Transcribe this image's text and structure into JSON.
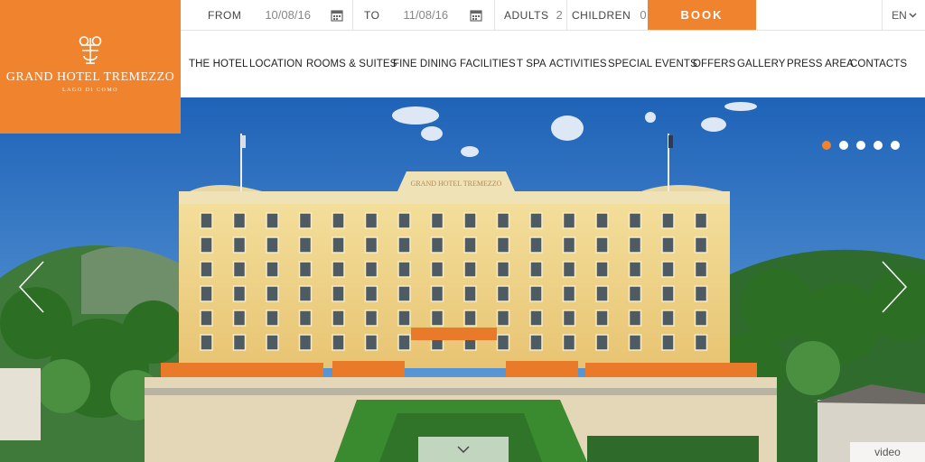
{
  "brand": {
    "name": "GRAND HOTEL TREMEZZO",
    "tagline": "LAGO DI COMO",
    "accent_color": "#f0832d"
  },
  "booking": {
    "from_label": "FROM",
    "from_value": "10/08/16",
    "to_label": "TO",
    "to_value": "11/08/16",
    "adults_label": "ADULTS",
    "adults_value": "2",
    "children_label": "CHILDREN",
    "children_value": "0",
    "book_label": "BOOK",
    "calendar_icon": "calendar-icon"
  },
  "language": {
    "selected": "EN",
    "icon": "chevron-down-icon"
  },
  "nav": {
    "items": [
      "THE HOTEL",
      "LOCATION",
      "ROOMS & SUITES",
      "FINE DINING",
      "FACILITIES",
      "T SPA",
      "ACTIVITIES",
      "SPECIAL EVENTS",
      "OFFERS",
      "GALLERY",
      "PRESS AREA",
      "CONTACTS"
    ]
  },
  "hero": {
    "building_sign": "GRAND HOTEL TREMEZZO",
    "slides_total": 5,
    "active_slide": 1,
    "prev_icon": "chevron-left-icon",
    "next_icon": "chevron-right-icon",
    "scroll_icon": "chevron-down-icon",
    "video_label": "video"
  }
}
